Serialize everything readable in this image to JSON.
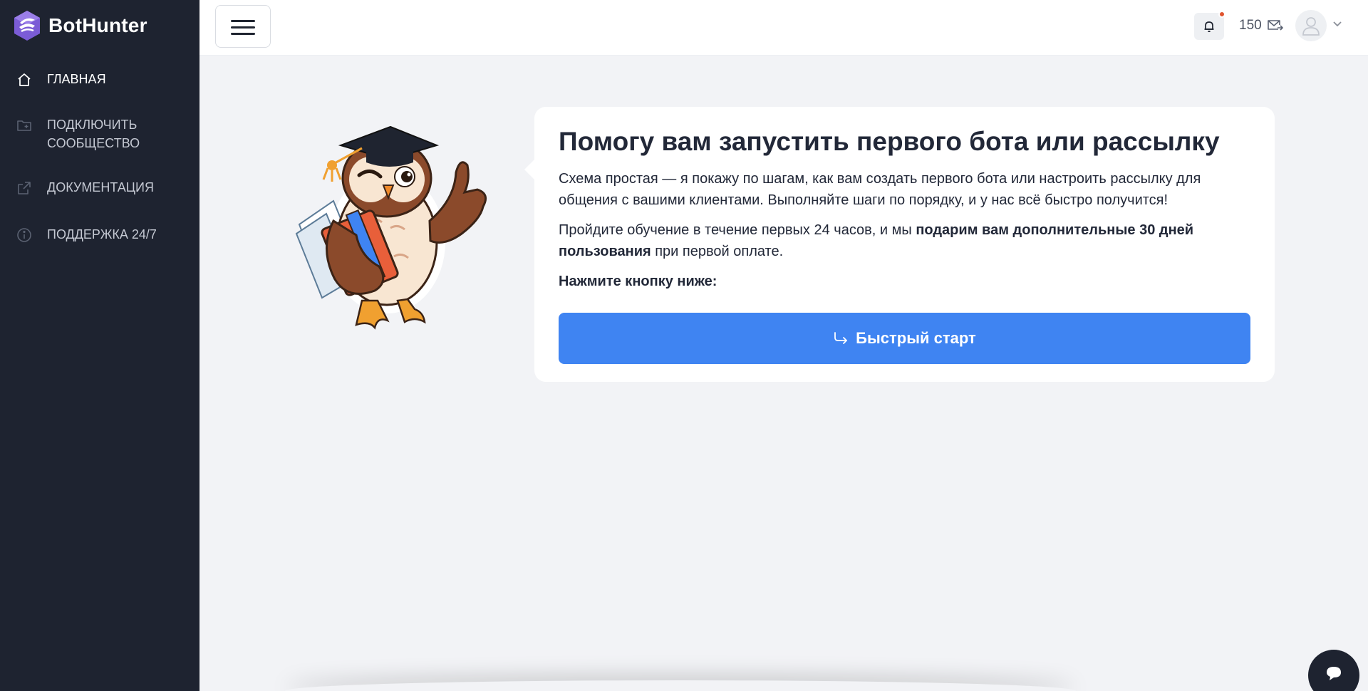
{
  "brand": {
    "name": "BotHunter"
  },
  "sidebar": {
    "items": [
      {
        "label": "ГЛАВНАЯ",
        "icon": "home-icon",
        "active": true
      },
      {
        "label": "ПОДКЛЮЧИТЬ СООБЩЕСТВО",
        "icon": "folder-plus-icon",
        "active": false
      },
      {
        "label": "ДОКУМЕНТАЦИЯ",
        "icon": "external-link-icon",
        "active": false
      },
      {
        "label": "ПОДДЕРЖКА 24/7",
        "icon": "info-icon",
        "active": false
      }
    ]
  },
  "header": {
    "credits": "150",
    "notification_dot_color": "#e0542f"
  },
  "card": {
    "title": "Помогу вам запустить первого бота или рассылку",
    "p1": "Схема простая — я покажу по шагам, как вам создать первого бота или настроить рассылку для общения с вашими клиентами. Выполняйте шаги по порядку, и у нас всё быстро получится!",
    "p2_start": "Пройдите обучение в течение первых 24 часов, и мы ",
    "p2_bold": "подарим вам дополнительные 30 дней пользования",
    "p2_end": " при первой оплате.",
    "p3": "Нажмите кнопку ниже:",
    "button_label": "Быстрый старт"
  },
  "colors": {
    "sidebar_bg": "#1e2330",
    "page_bg": "#f2f3f6",
    "primary": "#3f84f2",
    "brand_purple": "#7b5cd6"
  }
}
